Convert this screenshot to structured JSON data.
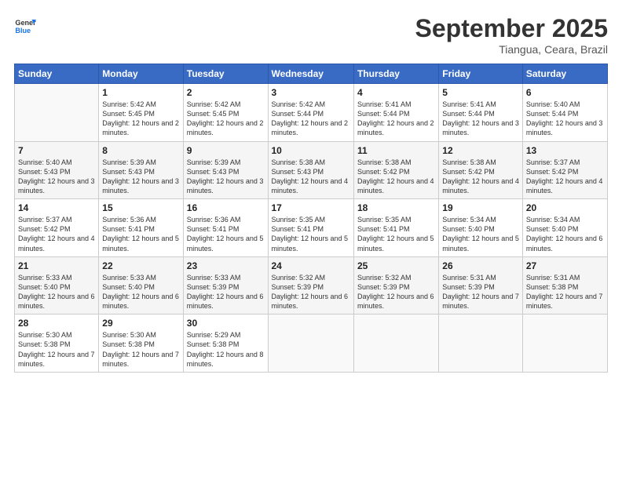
{
  "header": {
    "logo": {
      "line1": "General",
      "line2": "Blue"
    },
    "title": "September 2025",
    "subtitle": "Tiangua, Ceara, Brazil"
  },
  "days_of_week": [
    "Sunday",
    "Monday",
    "Tuesday",
    "Wednesday",
    "Thursday",
    "Friday",
    "Saturday"
  ],
  "weeks": [
    {
      "days": [
        {
          "num": "",
          "empty": true
        },
        {
          "num": "1",
          "sunrise": "5:42 AM",
          "sunset": "5:45 PM",
          "daylight": "12 hours and 2 minutes."
        },
        {
          "num": "2",
          "sunrise": "5:42 AM",
          "sunset": "5:45 PM",
          "daylight": "12 hours and 2 minutes."
        },
        {
          "num": "3",
          "sunrise": "5:42 AM",
          "sunset": "5:44 PM",
          "daylight": "12 hours and 2 minutes."
        },
        {
          "num": "4",
          "sunrise": "5:41 AM",
          "sunset": "5:44 PM",
          "daylight": "12 hours and 2 minutes."
        },
        {
          "num": "5",
          "sunrise": "5:41 AM",
          "sunset": "5:44 PM",
          "daylight": "12 hours and 3 minutes."
        },
        {
          "num": "6",
          "sunrise": "5:40 AM",
          "sunset": "5:44 PM",
          "daylight": "12 hours and 3 minutes."
        }
      ]
    },
    {
      "days": [
        {
          "num": "7",
          "sunrise": "5:40 AM",
          "sunset": "5:43 PM",
          "daylight": "12 hours and 3 minutes."
        },
        {
          "num": "8",
          "sunrise": "5:39 AM",
          "sunset": "5:43 PM",
          "daylight": "12 hours and 3 minutes."
        },
        {
          "num": "9",
          "sunrise": "5:39 AM",
          "sunset": "5:43 PM",
          "daylight": "12 hours and 3 minutes."
        },
        {
          "num": "10",
          "sunrise": "5:38 AM",
          "sunset": "5:43 PM",
          "daylight": "12 hours and 4 minutes."
        },
        {
          "num": "11",
          "sunrise": "5:38 AM",
          "sunset": "5:42 PM",
          "daylight": "12 hours and 4 minutes."
        },
        {
          "num": "12",
          "sunrise": "5:38 AM",
          "sunset": "5:42 PM",
          "daylight": "12 hours and 4 minutes."
        },
        {
          "num": "13",
          "sunrise": "5:37 AM",
          "sunset": "5:42 PM",
          "daylight": "12 hours and 4 minutes."
        }
      ]
    },
    {
      "days": [
        {
          "num": "14",
          "sunrise": "5:37 AM",
          "sunset": "5:42 PM",
          "daylight": "12 hours and 4 minutes."
        },
        {
          "num": "15",
          "sunrise": "5:36 AM",
          "sunset": "5:41 PM",
          "daylight": "12 hours and 5 minutes."
        },
        {
          "num": "16",
          "sunrise": "5:36 AM",
          "sunset": "5:41 PM",
          "daylight": "12 hours and 5 minutes."
        },
        {
          "num": "17",
          "sunrise": "5:35 AM",
          "sunset": "5:41 PM",
          "daylight": "12 hours and 5 minutes."
        },
        {
          "num": "18",
          "sunrise": "5:35 AM",
          "sunset": "5:41 PM",
          "daylight": "12 hours and 5 minutes."
        },
        {
          "num": "19",
          "sunrise": "5:34 AM",
          "sunset": "5:40 PM",
          "daylight": "12 hours and 5 minutes."
        },
        {
          "num": "20",
          "sunrise": "5:34 AM",
          "sunset": "5:40 PM",
          "daylight": "12 hours and 6 minutes."
        }
      ]
    },
    {
      "days": [
        {
          "num": "21",
          "sunrise": "5:33 AM",
          "sunset": "5:40 PM",
          "daylight": "12 hours and 6 minutes."
        },
        {
          "num": "22",
          "sunrise": "5:33 AM",
          "sunset": "5:40 PM",
          "daylight": "12 hours and 6 minutes."
        },
        {
          "num": "23",
          "sunrise": "5:33 AM",
          "sunset": "5:39 PM",
          "daylight": "12 hours and 6 minutes."
        },
        {
          "num": "24",
          "sunrise": "5:32 AM",
          "sunset": "5:39 PM",
          "daylight": "12 hours and 6 minutes."
        },
        {
          "num": "25",
          "sunrise": "5:32 AM",
          "sunset": "5:39 PM",
          "daylight": "12 hours and 6 minutes."
        },
        {
          "num": "26",
          "sunrise": "5:31 AM",
          "sunset": "5:39 PM",
          "daylight": "12 hours and 7 minutes."
        },
        {
          "num": "27",
          "sunrise": "5:31 AM",
          "sunset": "5:38 PM",
          "daylight": "12 hours and 7 minutes."
        }
      ]
    },
    {
      "days": [
        {
          "num": "28",
          "sunrise": "5:30 AM",
          "sunset": "5:38 PM",
          "daylight": "12 hours and 7 minutes."
        },
        {
          "num": "29",
          "sunrise": "5:30 AM",
          "sunset": "5:38 PM",
          "daylight": "12 hours and 7 minutes."
        },
        {
          "num": "30",
          "sunrise": "5:29 AM",
          "sunset": "5:38 PM",
          "daylight": "12 hours and 8 minutes."
        },
        {
          "num": "",
          "empty": true
        },
        {
          "num": "",
          "empty": true
        },
        {
          "num": "",
          "empty": true
        },
        {
          "num": "",
          "empty": true
        }
      ]
    }
  ]
}
